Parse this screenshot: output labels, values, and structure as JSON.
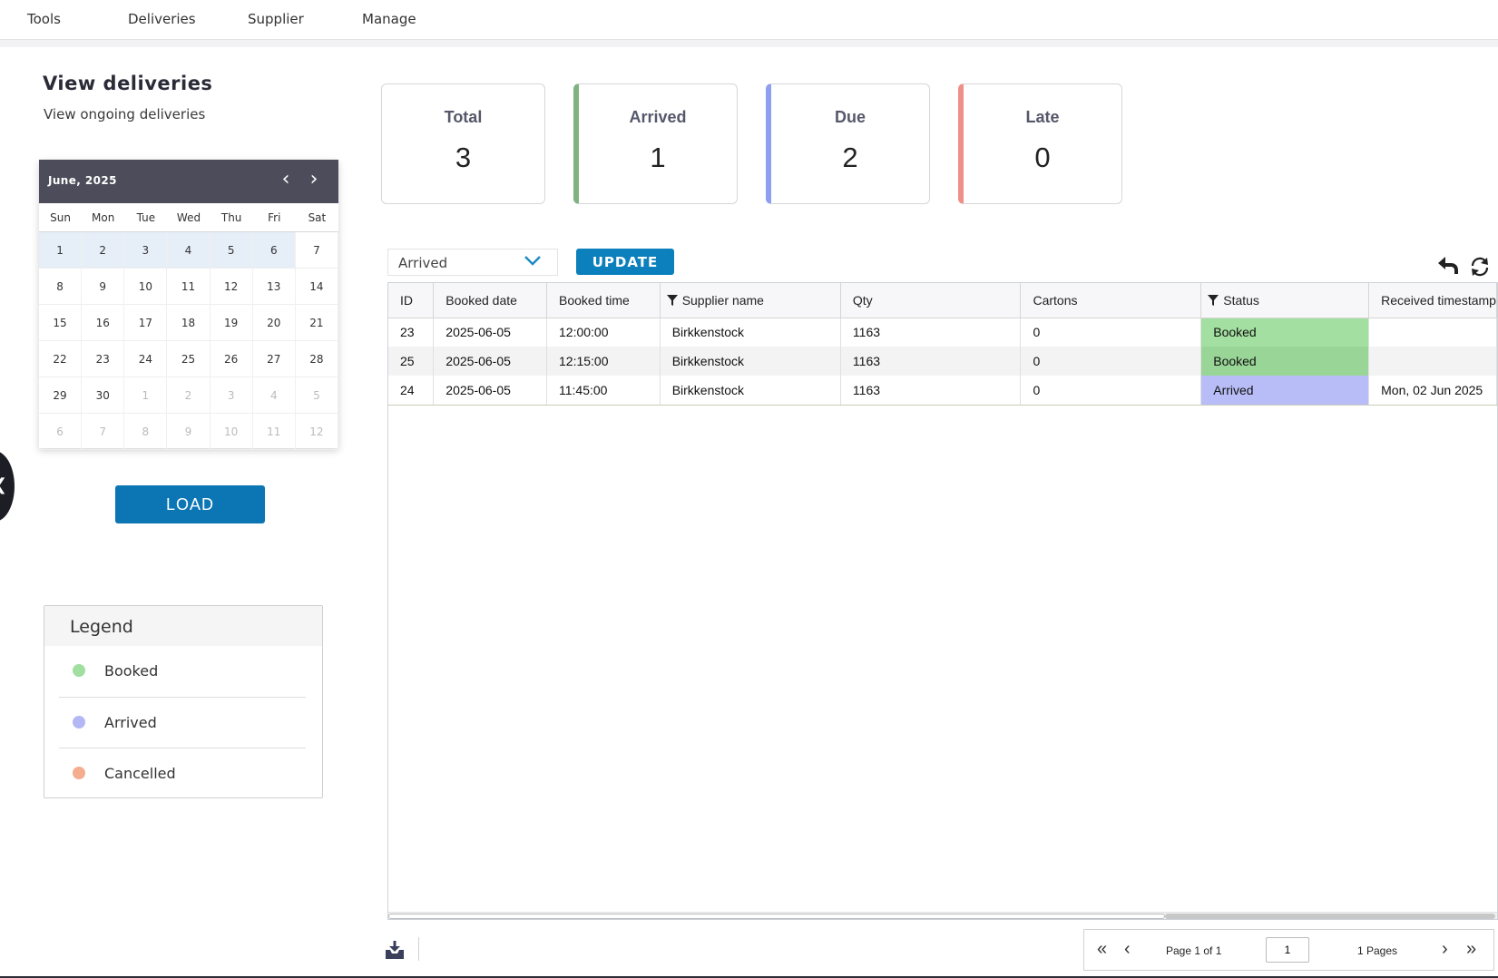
{
  "menu": [
    "Tools",
    "Deliveries",
    "Supplier",
    "Manage"
  ],
  "header": {
    "title": "View deliveries",
    "subtitle": "View ongoing deliveries"
  },
  "calendar": {
    "month_label": "June, 2025",
    "weekdays": [
      "Sun",
      "Mon",
      "Tue",
      "Wed",
      "Thu",
      "Fri",
      "Sat"
    ],
    "weeks": [
      [
        "1",
        "2",
        "3",
        "4",
        "5",
        "6",
        "7"
      ],
      [
        "8",
        "9",
        "10",
        "11",
        "12",
        "13",
        "14"
      ],
      [
        "15",
        "16",
        "17",
        "18",
        "19",
        "20",
        "21"
      ],
      [
        "22",
        "23",
        "24",
        "25",
        "26",
        "27",
        "28"
      ],
      [
        "29",
        "30",
        "1",
        "2",
        "3",
        "4",
        "5"
      ],
      [
        "6",
        "7",
        "8",
        "9",
        "10",
        "11",
        "12"
      ]
    ]
  },
  "load_label": "LOAD",
  "legend": {
    "title": "Legend",
    "items": [
      {
        "label": "Booked",
        "color": "#a0dfa0"
      },
      {
        "label": "Arrived",
        "color": "#b3b8f5"
      },
      {
        "label": "Cancelled",
        "color": "#f4ad8f"
      }
    ]
  },
  "stats": [
    {
      "label": "Total",
      "value": "3",
      "accent": ""
    },
    {
      "label": "Arrived",
      "value": "1",
      "accent": "#7fb37f"
    },
    {
      "label": "Due",
      "value": "2",
      "accent": "#8e9ef0"
    },
    {
      "label": "Late",
      "value": "0",
      "accent": "#ee9088"
    }
  ],
  "toolbar": {
    "status_value": "Arrived",
    "update_label": "UPDATE"
  },
  "table": {
    "columns": [
      "ID",
      "Booked date",
      "Booked time",
      "Supplier name",
      "Qty",
      "Cartons",
      "Status",
      "Received timestamp"
    ],
    "rows": [
      [
        "23",
        "2025-06-05",
        "12:00:00",
        "Birkkenstock",
        "1163",
        "0",
        "Booked",
        ""
      ],
      [
        "25",
        "2025-06-05",
        "12:15:00",
        "Birkkenstock",
        "1163",
        "0",
        "Booked",
        ""
      ],
      [
        "24",
        "2025-06-05",
        "11:45:00",
        "Birkkenstock",
        "1163",
        "0",
        "Arrived",
        "Mon, 02 Jun 2025"
      ]
    ]
  },
  "pager": {
    "page_text": "Page 1 of 1",
    "page_input": "1",
    "pages_text": "1 Pages"
  }
}
